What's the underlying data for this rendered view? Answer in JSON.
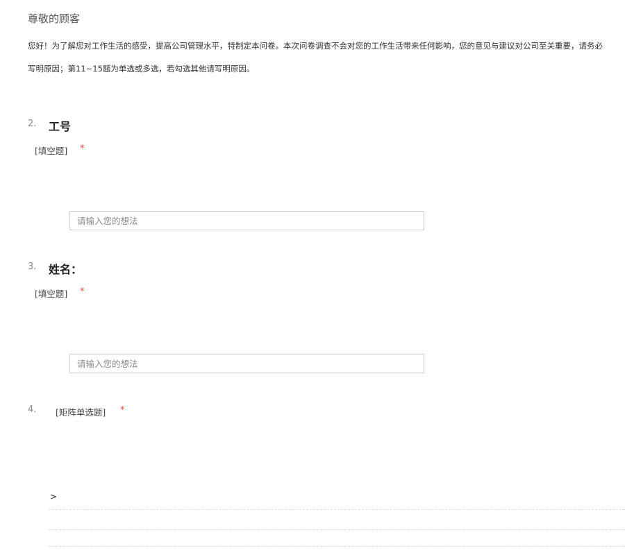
{
  "header": {
    "greeting": "尊敬的顾客",
    "intro_line1": "您好！为了解您对工作生活的感受，提高公司管理水平，特制定本问卷。本次问卷调查不会对您的工作生活带来任何影响，您的意见与建议对公司至关重要，请务必",
    "intro_line2": "写明原因；第11~15题为单选或多选，若勾选其他请写明原因。"
  },
  "questions": [
    {
      "number": "2.",
      "title": "工号",
      "type": "[填空题]",
      "required": "*",
      "placeholder": "请输入您的想法"
    },
    {
      "number": "3.",
      "title": "姓名：",
      "type": "[填空题]",
      "required": "*",
      "placeholder": "请输入您的想法"
    },
    {
      "number": "4.",
      "type": "[矩阵单选题]",
      "required": "*",
      "row_caret": ">"
    }
  ]
}
